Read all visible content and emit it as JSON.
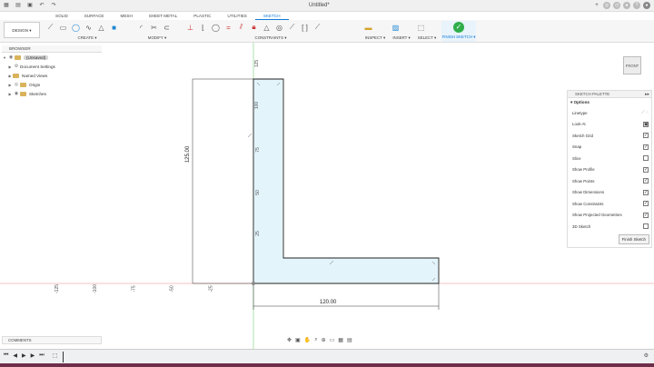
{
  "titlebar": {
    "title": "Untitled*"
  },
  "tabs": [
    "SOLID",
    "SURFACE",
    "MESH",
    "SHEET METAL",
    "PLASTIC",
    "UTILITIES",
    "SKETCH"
  ],
  "active_tab": "SKETCH",
  "ribbon": {
    "design": "DESIGN ▾",
    "create": "CREATE ▾",
    "modify": "MODIFY ▾",
    "constraints": "CONSTRAINTS ▾",
    "inspect": "INSPECT ▾",
    "insert": "INSERT ▾",
    "select": "SELECT ▾",
    "finish": "FINISH SKETCH ▾"
  },
  "browser": {
    "title": "BROWSER",
    "items": [
      {
        "label": "(Unsaved)"
      },
      {
        "label": "Document Settings"
      },
      {
        "label": "Named Views"
      },
      {
        "label": "Origin"
      },
      {
        "label": "Sketches"
      }
    ]
  },
  "viewcube": "FRONT",
  "ruler": {
    "x_labels": [
      "-125",
      "-100",
      "-75",
      "-50",
      "-25"
    ],
    "y_labels": [
      "125",
      "100",
      "75",
      "50",
      "25"
    ]
  },
  "dimensions": {
    "height": "125.00",
    "width": "120.00"
  },
  "palette": {
    "title": "SKETCH PALETTE",
    "options_label": "Options",
    "rows": [
      {
        "label": "Linetype",
        "state": ""
      },
      {
        "label": "Look At",
        "state": ""
      },
      {
        "label": "Sketch Grid",
        "state": "✓"
      },
      {
        "label": "Snap",
        "state": "✓"
      },
      {
        "label": "Slice",
        "state": ""
      },
      {
        "label": "Show Profile",
        "state": "✓"
      },
      {
        "label": "Show Points",
        "state": "✓"
      },
      {
        "label": "Show Dimensions",
        "state": "✓"
      },
      {
        "label": "Show Constraints",
        "state": "✓"
      },
      {
        "label": "Show Projected Geometries",
        "state": "✓"
      },
      {
        "label": "3D Sketch",
        "state": ""
      }
    ],
    "finish_button": "Finish Sketch"
  },
  "comments": {
    "label": "COMMENTS"
  }
}
